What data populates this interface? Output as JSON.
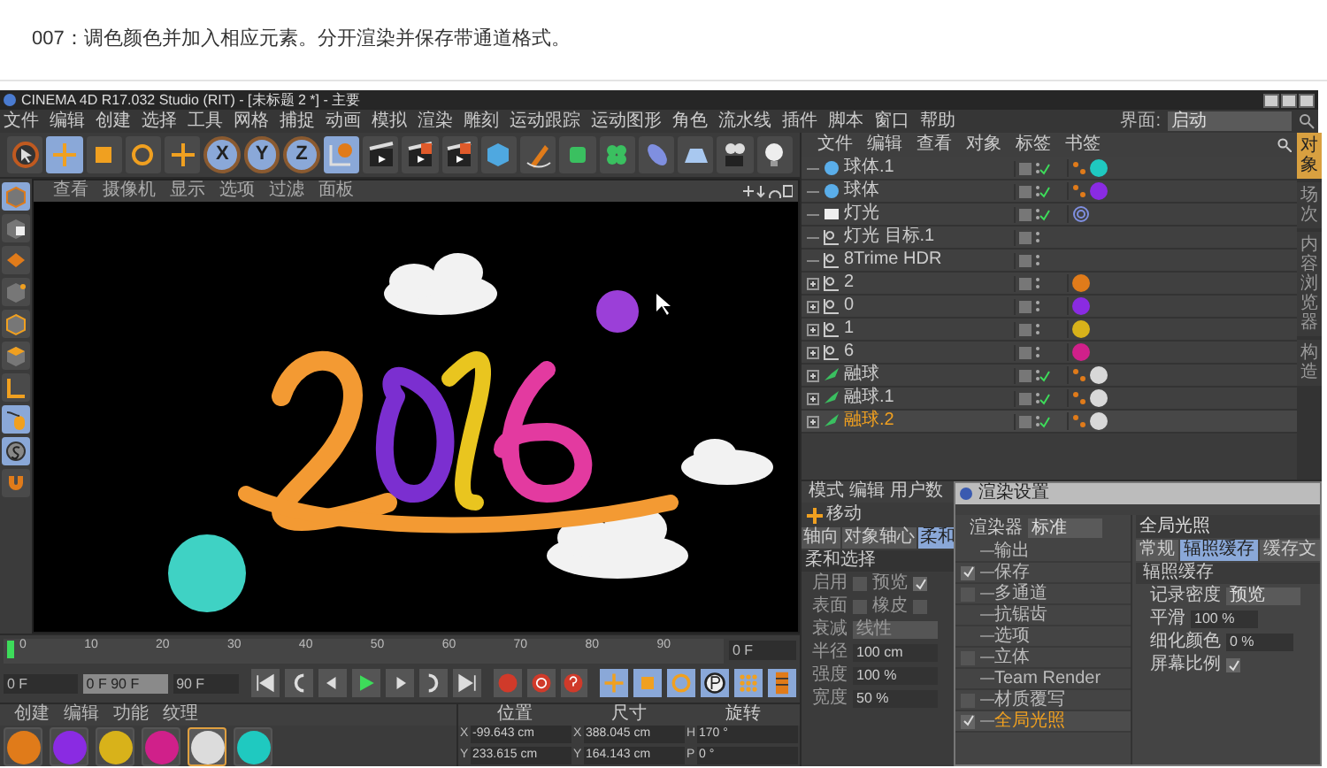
{
  "caption": "007：调色颜色并加入相应元素。分开渲染并保存带通道格式。",
  "window": {
    "title": "CINEMA 4D R17.032 Studio (RIT) - [未标题 2 *] - 主要"
  },
  "menu": [
    "文件",
    "编辑",
    "创建",
    "选择",
    "工具",
    "网格",
    "捕捉",
    "动画",
    "模拟",
    "渲染",
    "雕刻",
    "运动跟踪",
    "运动图形",
    "角色",
    "流水线",
    "插件",
    "脚本",
    "窗口",
    "帮助"
  ],
  "layout": {
    "label": "界面:",
    "value": "启动"
  },
  "toolbar_axes": [
    "X",
    "Y",
    "Z"
  ],
  "viewport": {
    "menu": [
      "查看",
      "摄像机",
      "显示",
      "选项",
      "过滤",
      "面板"
    ]
  },
  "object_manager": {
    "menu": [
      "文件",
      "编辑",
      "查看",
      "对象",
      "标签",
      "书签"
    ],
    "objects": [
      {
        "name": "球体.1",
        "kind": "sphere",
        "checked": true,
        "color": "#1fc9c0",
        "selected": false
      },
      {
        "name": "球体",
        "kind": "sphere",
        "checked": true,
        "color": "#8a2be2",
        "selected": false
      },
      {
        "name": "灯光",
        "kind": "light",
        "checked": true,
        "selected": false
      },
      {
        "name": "灯光 目标.1",
        "kind": "null",
        "checked": false,
        "selected": false
      },
      {
        "name": "8Trime HDR",
        "kind": "null",
        "checked": false,
        "selected": false
      },
      {
        "name": "2",
        "kind": "null",
        "checked": false,
        "expanded": false,
        "color": "#e07b1a",
        "selected": false
      },
      {
        "name": "0",
        "kind": "null",
        "checked": false,
        "expanded": false,
        "color": "#8a2be2",
        "selected": false
      },
      {
        "name": "1",
        "kind": "null",
        "checked": false,
        "expanded": false,
        "color": "#d8b21a",
        "selected": false
      },
      {
        "name": "6",
        "kind": "null",
        "checked": false,
        "expanded": false,
        "color": "#d0208a",
        "selected": false
      },
      {
        "name": "融球",
        "kind": "metaball",
        "checked": true,
        "expanded": false,
        "color": "#d8d8d8",
        "selected": false
      },
      {
        "name": "融球.1",
        "kind": "metaball",
        "checked": true,
        "expanded": false,
        "color": "#d8d8d8",
        "selected": false
      },
      {
        "name": "融球.2",
        "kind": "metaball",
        "checked": true,
        "expanded": false,
        "color": "#d8d8d8",
        "selected": true
      }
    ],
    "side_tabs": [
      {
        "label": "对象",
        "selected": true
      },
      {
        "label": "场次",
        "selected": false
      },
      {
        "label": "内容浏览器",
        "selected": false
      },
      {
        "label": "构造",
        "selected": false
      }
    ]
  },
  "attributes": {
    "menu": [
      "模式",
      "编辑",
      "用户数"
    ],
    "tool": "移动",
    "tabs": [
      {
        "label": "轴向",
        "selected": false
      },
      {
        "label": "对象轴心",
        "selected": false
      },
      {
        "label": "柔和",
        "selected": true
      }
    ],
    "section": "柔和选择",
    "rows": [
      {
        "kind": "checks",
        "items": [
          {
            "label": "启用",
            "checked": false
          },
          {
            "label": "预览",
            "checked": true
          }
        ]
      },
      {
        "kind": "checks",
        "items": [
          {
            "label": "表面",
            "checked": false
          },
          {
            "label": "橡皮",
            "checked": false
          }
        ]
      },
      {
        "kind": "dropdown",
        "label": "衰减",
        "value": "线性"
      },
      {
        "kind": "field",
        "label": "半径",
        "value": "100 cm"
      },
      {
        "kind": "field",
        "label": "强度",
        "value": "100 %"
      },
      {
        "kind": "field",
        "label": "宽度",
        "value": "50 %"
      }
    ]
  },
  "render_settings": {
    "title": "渲染设置",
    "renderer_label": "渲染器",
    "renderer": "标准",
    "items": [
      {
        "label": "输出",
        "kind": "plain",
        "selected": false
      },
      {
        "label": "保存",
        "kind": "check",
        "checked": true,
        "selected": false
      },
      {
        "label": "多通道",
        "kind": "check",
        "checked": false,
        "selected": false
      },
      {
        "label": "抗锯齿",
        "kind": "plain",
        "selected": false
      },
      {
        "label": "选项",
        "kind": "plain",
        "selected": false
      },
      {
        "label": "立体",
        "kind": "check",
        "checked": false,
        "selected": false
      },
      {
        "label": "Team Render",
        "kind": "plain",
        "selected": false
      },
      {
        "label": "材质覆写",
        "kind": "check",
        "checked": false,
        "selected": false
      },
      {
        "label": "全局光照",
        "kind": "check",
        "checked": true,
        "selected": true
      }
    ],
    "heading": "全局光照",
    "tabs": [
      {
        "label": "常规",
        "selected": false
      },
      {
        "label": "辐照缓存",
        "selected": true
      },
      {
        "label": "缓存文",
        "selected": false
      }
    ],
    "section": "辐照缓存",
    "rows": [
      {
        "kind": "dropdown",
        "label": "记录密度",
        "value": "预览"
      },
      {
        "kind": "field",
        "label": "平滑",
        "value": "100 %"
      },
      {
        "kind": "field",
        "label": "细化颜色",
        "value": "0 %"
      },
      {
        "kind": "check",
        "label": "屏幕比例",
        "checked": true
      }
    ]
  },
  "timeline": {
    "ticks": [
      "0",
      "10",
      "20",
      "30",
      "40",
      "50",
      "60",
      "70",
      "80",
      "90"
    ],
    "current": "0 F",
    "start": "0 F",
    "range": {
      "label": "0 F 90 F",
      "level": 1
    },
    "end": "90 F"
  },
  "materials": {
    "menu": [
      "创建",
      "编辑",
      "功能",
      "纹理"
    ],
    "swatches": [
      {
        "color": "#e07b1a",
        "selected": false
      },
      {
        "color": "#8a2be2",
        "selected": false
      },
      {
        "color": "#d8b21a",
        "selected": false
      },
      {
        "color": "#d0208a",
        "selected": false
      },
      {
        "color": "#dcdcdc",
        "selected": true
      },
      {
        "color": "#1fc9c0",
        "selected": false
      }
    ]
  },
  "coordinates": {
    "headers": [
      "位置",
      "尺寸",
      "旋转"
    ],
    "rows": [
      [
        {
          "axis": "X",
          "value": "-99.643 cm"
        },
        {
          "axis": "X",
          "value": "388.045 cm"
        },
        {
          "axis": "H",
          "value": "170 °"
        }
      ],
      [
        {
          "axis": "Y",
          "value": "233.615 cm"
        },
        {
          "axis": "Y",
          "value": "164.143 cm"
        },
        {
          "axis": "P",
          "value": "0 °"
        }
      ]
    ]
  }
}
